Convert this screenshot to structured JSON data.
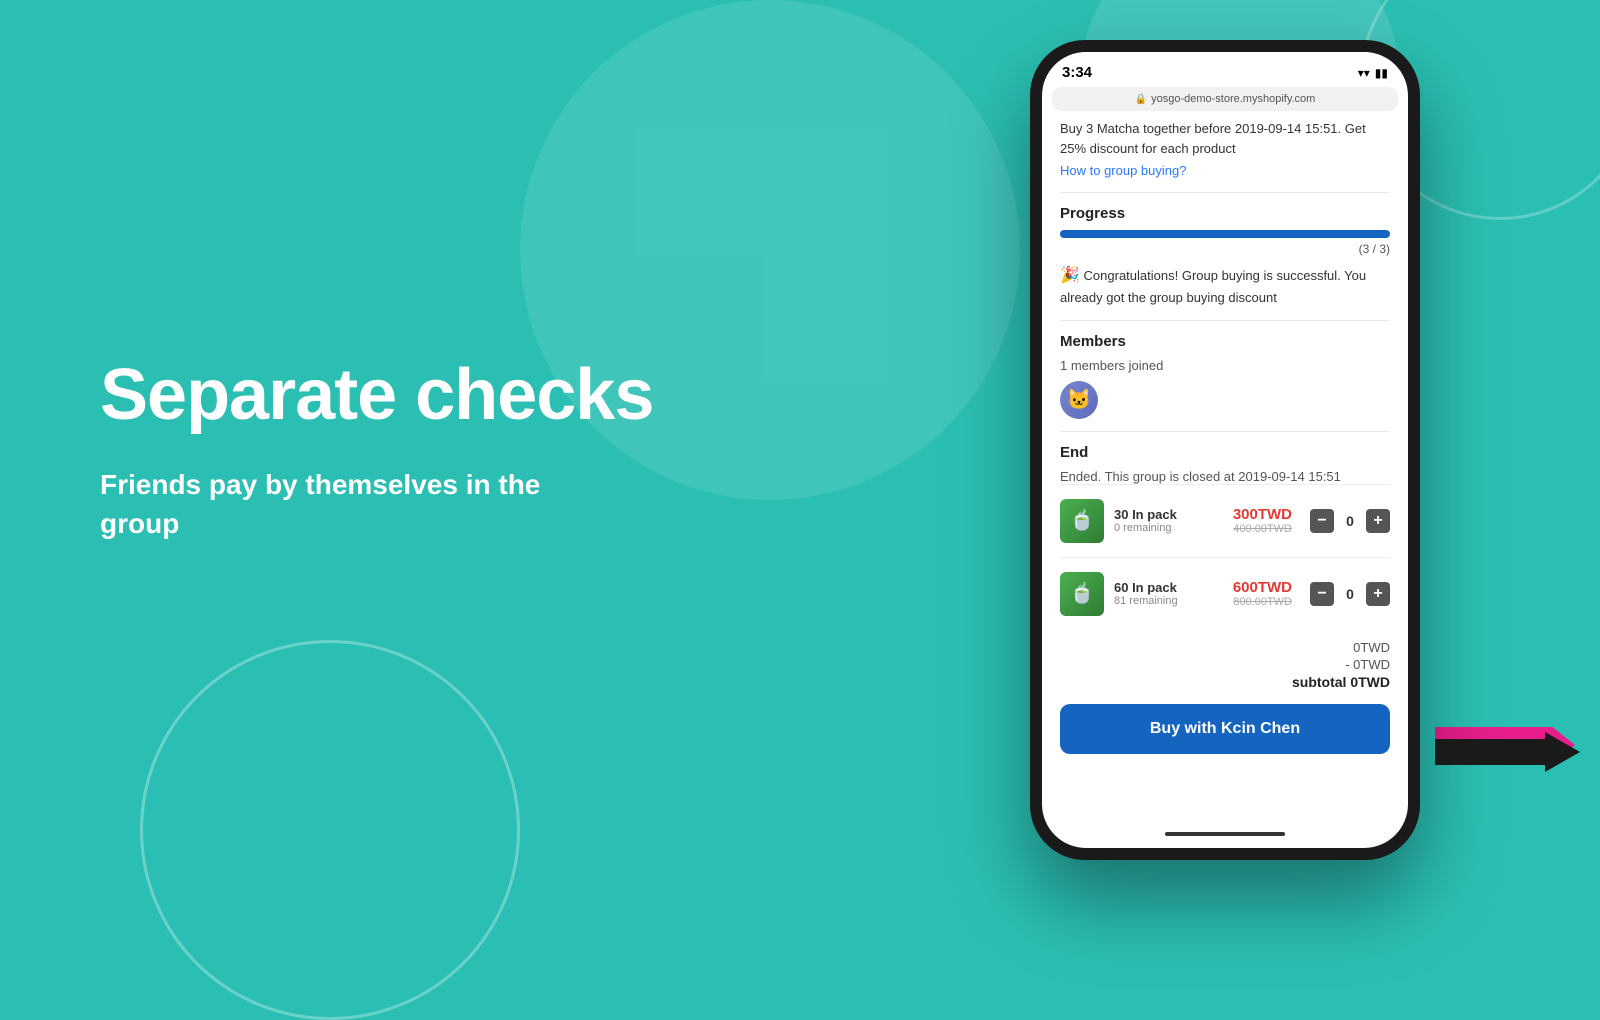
{
  "background_color": "#2bbfb3",
  "left": {
    "title": "Separate checks",
    "subtitle": "Friends pay by themselves in the group"
  },
  "phone": {
    "status_bar": {
      "time": "3:34",
      "url": "yosgo-demo-store.myshopify.com"
    },
    "group_info": {
      "description": "Buy 3 Matcha together before 2019-09-14 15:51. Get 25% discount for each product",
      "link_text": "How to group buying?"
    },
    "progress": {
      "label": "Progress",
      "value": "(3 / 3)",
      "fill_percent": 100,
      "congrats_emoji": "🎉",
      "congrats_text": "Congratulations! Group buying is successful. You already got the group buying discount"
    },
    "members": {
      "label": "Members",
      "count_text": "1 members joined"
    },
    "end": {
      "label": "End",
      "text": "Ended. This group is closed at 2019-09-14 15:51"
    },
    "products": [
      {
        "name": "30 In pack",
        "remaining": "0 remaining",
        "price_current": "300TWD",
        "price_original": "400.00TWD",
        "qty": 0
      },
      {
        "name": "60 In pack",
        "remaining": "81 remaining",
        "price_current": "600TWD",
        "price_original": "800.00TWD",
        "qty": 0
      }
    ],
    "totals": {
      "line1": "0TWD",
      "discount": "- 0TWD",
      "subtotal_label": "subtotal",
      "subtotal": "0TWD"
    },
    "buy_button_label": "Buy with Kcin Chen"
  }
}
